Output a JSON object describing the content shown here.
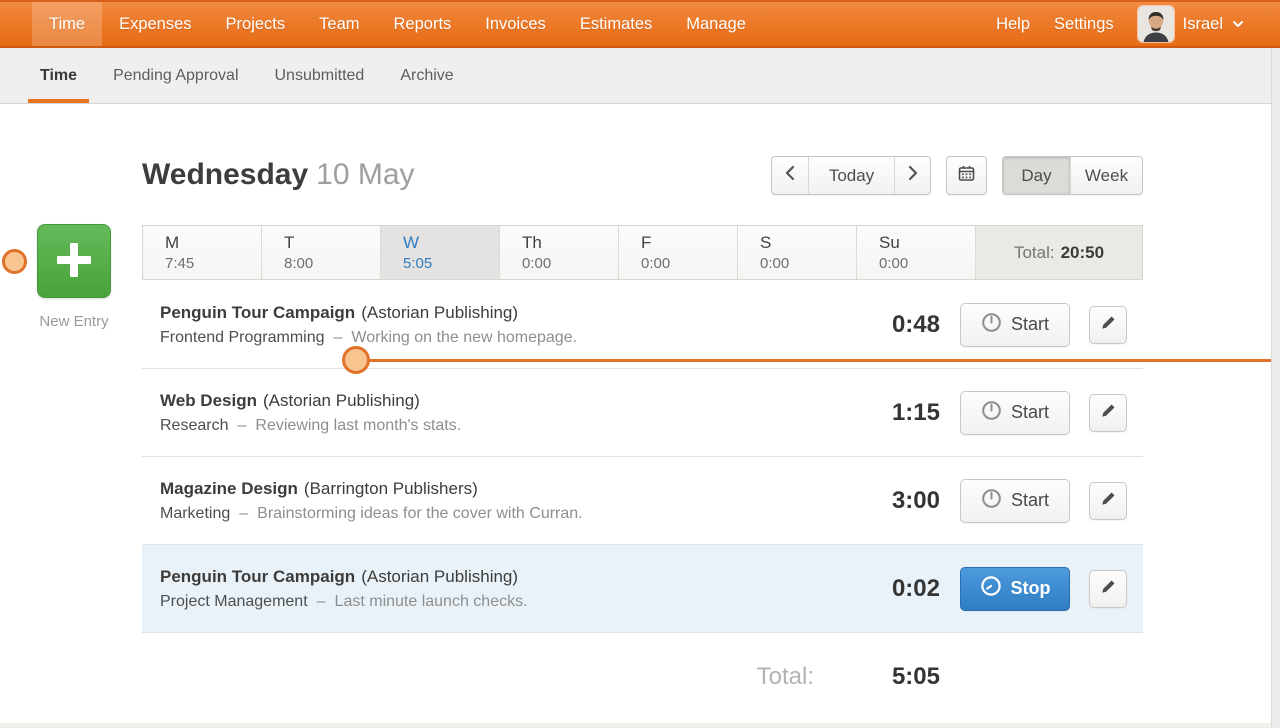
{
  "topnav": {
    "items": [
      "Time",
      "Expenses",
      "Projects",
      "Team",
      "Reports",
      "Invoices",
      "Estimates",
      "Manage"
    ],
    "active": "Time",
    "help": "Help",
    "settings": "Settings",
    "user": "Israel"
  },
  "subnav": {
    "items": [
      "Time",
      "Pending Approval",
      "Unsubmitted",
      "Archive"
    ],
    "active": "Time"
  },
  "header": {
    "title_day": "Wednesday",
    "title_date": "10 May",
    "today": "Today",
    "day": "Day",
    "week": "Week"
  },
  "week": {
    "days": [
      {
        "label": "M",
        "value": "7:45"
      },
      {
        "label": "T",
        "value": "8:00"
      },
      {
        "label": "W",
        "value": "5:05"
      },
      {
        "label": "Th",
        "value": "0:00"
      },
      {
        "label": "F",
        "value": "0:00"
      },
      {
        "label": "S",
        "value": "0:00"
      },
      {
        "label": "Su",
        "value": "0:00"
      }
    ],
    "active_day_index": 2,
    "total_label": "Total:",
    "total_value": "20:50"
  },
  "new_entry": {
    "label": "New Entry"
  },
  "entries": [
    {
      "project": "Penguin Tour Campaign",
      "client": "(Astorian Publishing)",
      "task": "Frontend Programming",
      "sep": "–",
      "notes": "Working on the new homepage.",
      "time": "0:48",
      "action": "Start",
      "running": false
    },
    {
      "project": "Web Design",
      "client": "(Astorian Publishing)",
      "task": "Research",
      "sep": "–",
      "notes": "Reviewing last month's stats.",
      "time": "1:15",
      "action": "Start",
      "running": false
    },
    {
      "project": "Magazine Design",
      "client": "(Barrington Publishers)",
      "task": "Marketing",
      "sep": "–",
      "notes": "Brainstorming ideas for the cover with Curran.",
      "time": "3:00",
      "action": "Start",
      "running": false
    },
    {
      "project": "Penguin Tour Campaign",
      "client": "(Astorian Publishing)",
      "task": "Project Management",
      "sep": "–",
      "notes": "Last minute launch checks.",
      "time": "0:02",
      "action": "Stop",
      "running": true
    }
  ],
  "footer": {
    "total_label": "Total:",
    "total_value": "5:05"
  },
  "icons": {
    "prev": "chevron-left",
    "next": "chevron-right",
    "calendar": "calendar",
    "timer": "clock",
    "edit": "pencil",
    "user_dropdown": "chevron-down",
    "new_entry": "plus"
  },
  "colors": {
    "nav_orange_top": "#f08a3e",
    "nav_orange_bottom": "#e66c15",
    "subnav_underline": "#e8751f",
    "active_day_blue": "#2e7dc1",
    "new_entry_green": "#4aa43c",
    "stop_blue": "#3787cd",
    "running_row_bg": "#e9f2f8",
    "callout_border": "#e0722a",
    "callout_fill": "#f8c48f"
  }
}
